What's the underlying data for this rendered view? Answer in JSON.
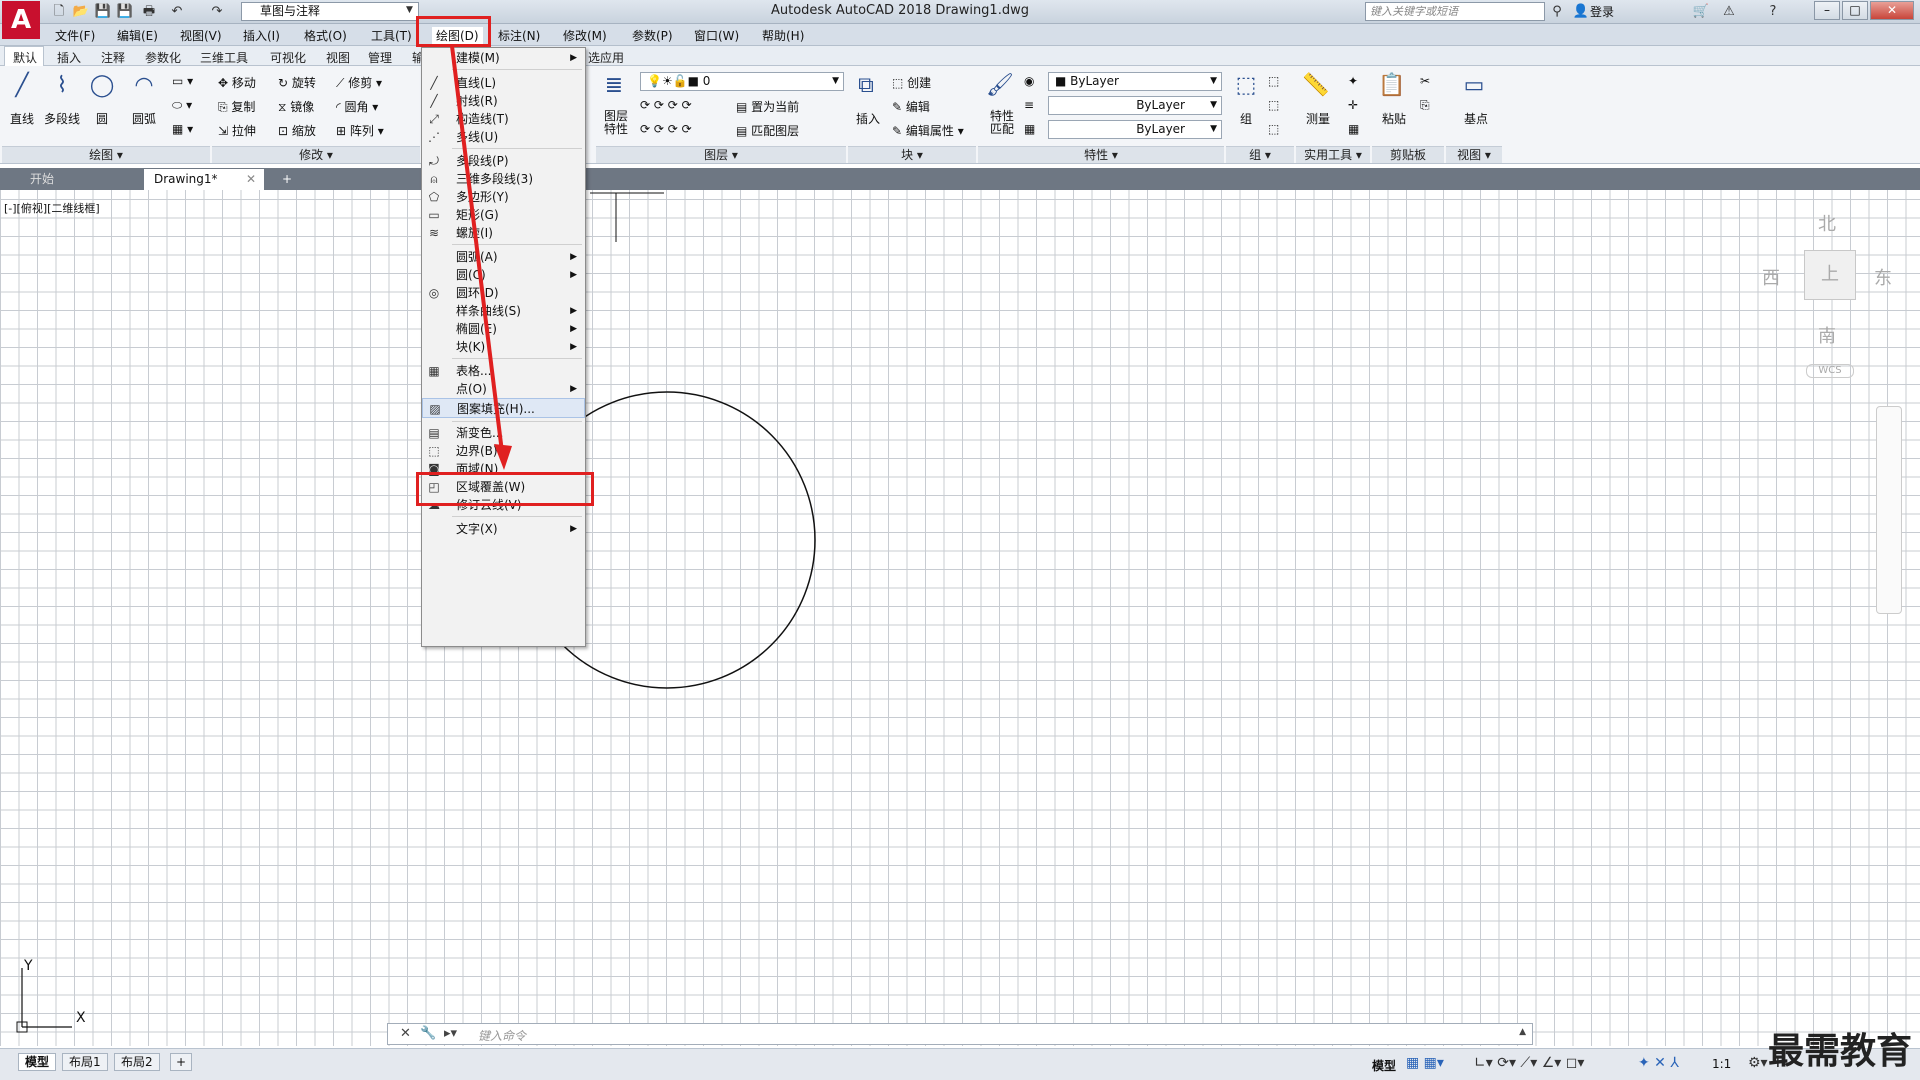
{
  "title_bar": {
    "workspace": "草图与注释",
    "app_title": "Autodesk AutoCAD 2018    Drawing1.dwg",
    "search_placeholder": "键入关键字或短语",
    "login": "登录"
  },
  "menu_bar": [
    "文件(F)",
    "编辑(E)",
    "视图(V)",
    "插入(I)",
    "格式(O)",
    "工具(T)",
    "绘图(D)",
    "标注(N)",
    "修改(M)",
    "参数(P)",
    "窗口(W)",
    "帮助(H)"
  ],
  "ribbon_tabs": [
    "默认",
    "插入",
    "注释",
    "参数化",
    "三维工具",
    "可视化",
    "视图",
    "管理",
    "输",
    "选应用"
  ],
  "ribbon": {
    "draw": {
      "buttons": [
        "直线",
        "多段线",
        "圆",
        "圆弧"
      ],
      "panel": "绘图"
    },
    "modify": {
      "buttons": [
        "移动",
        "旋转",
        "修剪",
        "复制",
        "镜像",
        "圆角",
        "拉伸",
        "缩放",
        "阵列"
      ],
      "panel": "修改"
    },
    "layers": {
      "buttons": [
        "图层特性",
        "置为当前",
        "匹配图层"
      ],
      "current_layer": "0",
      "panel": "图层"
    },
    "block": {
      "buttons": [
        "插入",
        "创建",
        "编辑",
        "编辑属性"
      ],
      "panel": "块"
    },
    "properties": {
      "match": "特性匹配",
      "color": "ByLayer",
      "linetype": "ByLayer",
      "lineweight": "ByLayer",
      "panel": "特性"
    },
    "group": {
      "button": "组",
      "panel": "组"
    },
    "utilities": {
      "button": "测量",
      "panel": "实用工具"
    },
    "clipboard": {
      "button": "粘贴",
      "panel": "剪贴板"
    },
    "view": {
      "button": "基点",
      "panel": "视图"
    }
  },
  "file_tabs": [
    "开始",
    "Drawing1*"
  ],
  "viewport_label": "[-][俯视][二维线框]",
  "viewcube": {
    "north": "北",
    "south": "南",
    "east": "东",
    "west": "西",
    "top": "上",
    "wcs": "WCS"
  },
  "ucs": {
    "x": "X",
    "y": "Y"
  },
  "draw_menu": {
    "items": [
      {
        "label": "建模(M)",
        "icon": "none",
        "submenu": true
      },
      {
        "label": "直线(L)",
        "icon": "line-icon",
        "submenu": false
      },
      {
        "label": "射线(R)",
        "icon": "ray-icon",
        "submenu": false
      },
      {
        "label": "构造线(T)",
        "icon": "xline-icon",
        "submenu": false
      },
      {
        "label": "多线(U)",
        "icon": "mline-icon",
        "submenu": false
      },
      {
        "label": "多段线(P)",
        "icon": "polyline-icon",
        "submenu": false
      },
      {
        "label": "三维多段线(3)",
        "icon": "3dpoly-icon",
        "submenu": false
      },
      {
        "label": "多边形(Y)",
        "icon": "polygon-icon",
        "submenu": false
      },
      {
        "label": "矩形(G)",
        "icon": "rectangle-icon",
        "submenu": false
      },
      {
        "label": "螺旋(I)",
        "icon": "helix-icon",
        "submenu": false
      },
      {
        "label": "圆弧(A)",
        "icon": "none",
        "submenu": true
      },
      {
        "label": "圆(C)",
        "icon": "none",
        "submenu": true
      },
      {
        "label": "圆环(D)",
        "icon": "donut-icon",
        "submenu": false
      },
      {
        "label": "样条曲线(S)",
        "icon": "none",
        "submenu": true
      },
      {
        "label": "椭圆(E)",
        "icon": "none",
        "submenu": true
      },
      {
        "label": "块(K)",
        "icon": "none",
        "submenu": true
      },
      {
        "label": "表格...",
        "icon": "table-icon",
        "submenu": false
      },
      {
        "label": "点(O)",
        "icon": "none",
        "submenu": true
      },
      {
        "label": "图案填充(H)...",
        "icon": "hatch-icon",
        "submenu": false
      },
      {
        "label": "渐变色...",
        "icon": "gradient-icon",
        "submenu": false
      },
      {
        "label": "边界(B)...",
        "icon": "boundary-icon",
        "submenu": false
      },
      {
        "label": "面域(N)",
        "icon": "region-icon",
        "submenu": false
      },
      {
        "label": "区域覆盖(W)",
        "icon": "wipeout-icon",
        "submenu": false
      },
      {
        "label": "修订云线(V)",
        "icon": "revcloud-icon",
        "submenu": false
      },
      {
        "label": "文字(X)",
        "icon": "none",
        "submenu": true
      }
    ]
  },
  "command_line": {
    "placeholder": "键入命令"
  },
  "layout_tabs": [
    "模型",
    "布局1",
    "布局2"
  ],
  "status": {
    "model": "模型",
    "scale": "1:1"
  },
  "watermark": "最需教育",
  "colors": {
    "highlight": "#e02020",
    "accent": "#c8102e"
  }
}
